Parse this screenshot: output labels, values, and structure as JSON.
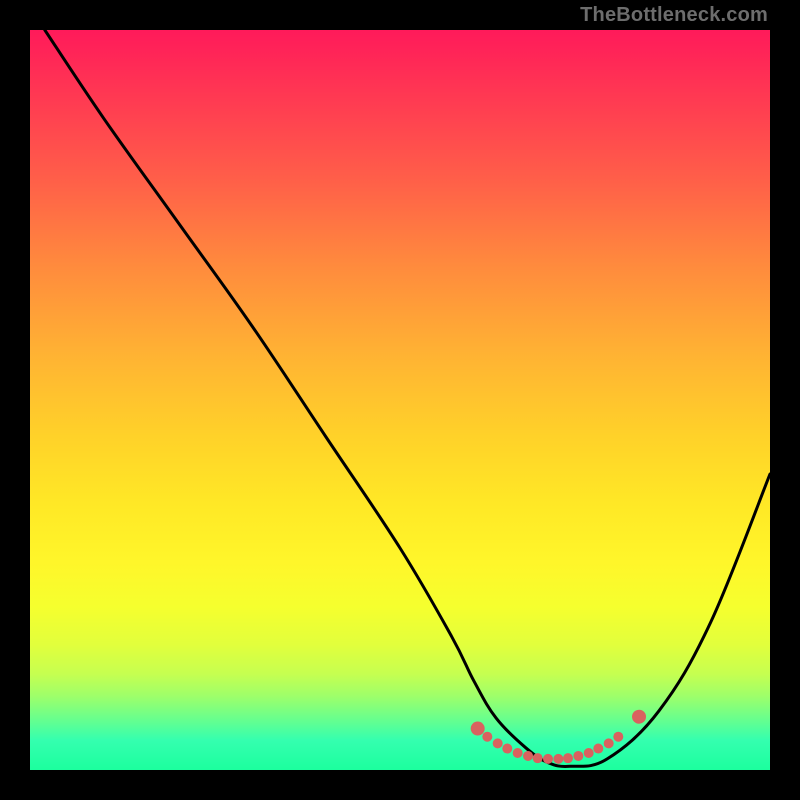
{
  "watermark": "TheBottleneck.com",
  "chart_data": {
    "type": "line",
    "title": "",
    "xlabel": "",
    "ylabel": "",
    "xlim": [
      0,
      100
    ],
    "ylim": [
      0,
      100
    ],
    "grid": false,
    "series": [
      {
        "name": "bottleneck-curve",
        "color": "#000000",
        "x": [
          2,
          10,
          20,
          30,
          40,
          50,
          57,
          60,
          63,
          67,
          70,
          73,
          78,
          85,
          92,
          100
        ],
        "y": [
          100,
          88,
          74,
          60,
          45,
          30,
          18,
          12,
          7,
          3,
          1,
          0.5,
          1.5,
          8,
          20,
          40
        ]
      }
    ],
    "markers": {
      "name": "flat-range",
      "color": "#d9625f",
      "points": [
        {
          "x": 60.5,
          "y": 5.6
        },
        {
          "x": 61.8,
          "y": 4.5
        },
        {
          "x": 63.2,
          "y": 3.6
        },
        {
          "x": 64.5,
          "y": 2.9
        },
        {
          "x": 65.9,
          "y": 2.3
        },
        {
          "x": 67.3,
          "y": 1.9
        },
        {
          "x": 68.6,
          "y": 1.6
        },
        {
          "x": 70.0,
          "y": 1.5
        },
        {
          "x": 71.4,
          "y": 1.5
        },
        {
          "x": 72.7,
          "y": 1.6
        },
        {
          "x": 74.1,
          "y": 1.9
        },
        {
          "x": 75.5,
          "y": 2.3
        },
        {
          "x": 76.8,
          "y": 2.9
        },
        {
          "x": 78.2,
          "y": 3.6
        },
        {
          "x": 79.5,
          "y": 4.5
        },
        {
          "x": 82.3,
          "y": 7.2
        }
      ]
    },
    "highlight_band": {
      "name": "green-strip",
      "y_from": 0,
      "y_to": 3,
      "color_note": "brighter green band at bottom of gradient"
    }
  }
}
